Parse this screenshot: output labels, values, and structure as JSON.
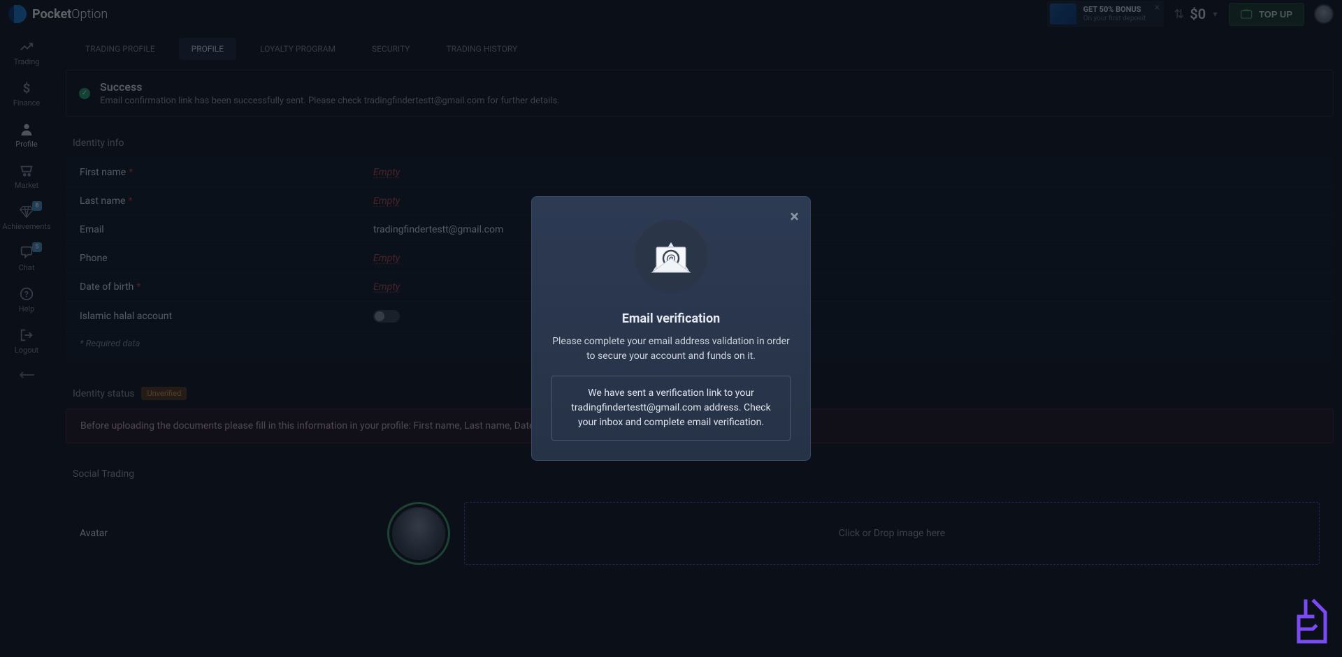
{
  "brand": {
    "name_bold": "Pocket",
    "name_light": "Option"
  },
  "header": {
    "bonus_title": "GET 50% BONUS",
    "bonus_sub": "On your first deposit",
    "balance": "$0",
    "topup_label": "TOP UP"
  },
  "sidebar": {
    "items": [
      {
        "label": "Trading"
      },
      {
        "label": "Finance"
      },
      {
        "label": "Profile"
      },
      {
        "label": "Market"
      },
      {
        "label": "Achievements",
        "badge": "8"
      },
      {
        "label": "Chat",
        "badge": "5"
      },
      {
        "label": "Help"
      },
      {
        "label": "Logout"
      }
    ]
  },
  "tabs": [
    {
      "label": "TRADING PROFILE"
    },
    {
      "label": "PROFILE",
      "active": true
    },
    {
      "label": "LOYALTY PROGRAM"
    },
    {
      "label": "SECURITY"
    },
    {
      "label": "TRADING HISTORY"
    }
  ],
  "alert": {
    "title": "Success",
    "message": "Email confirmation link has been successfully sent. Please check tradingfindertestt@gmail.com for further details."
  },
  "identity_section": {
    "title": "Identity info",
    "fields": {
      "first_name": {
        "label": "First name",
        "required": true,
        "value": "Empty",
        "empty": true
      },
      "last_name": {
        "label": "Last name",
        "required": true,
        "value": "Empty",
        "empty": true
      },
      "email": {
        "label": "Email",
        "required": false,
        "value": "tradingfindertestt@gmail.com",
        "empty": false
      },
      "phone": {
        "label": "Phone",
        "required": false,
        "value": "Empty",
        "empty": true
      },
      "dob": {
        "label": "Date of birth",
        "required": true,
        "value": "Empty",
        "empty": true
      },
      "halal": {
        "label": "Islamic halal account"
      }
    },
    "required_note": "* Required data"
  },
  "identity_status": {
    "label": "Identity status",
    "badge": "Unverified",
    "warning": "Before uploading the documents please fill in this information in your profile: First name, Last name, Date of birth"
  },
  "social": {
    "title": "Social Trading",
    "avatar_label": "Avatar",
    "dropzone": "Click or Drop image here"
  },
  "modal": {
    "title": "Email verification",
    "desc": "Please complete your email address validation in order to secure your account and funds on it.",
    "box": "We have sent a verification link to your tradingfindertestt@gmail.com address. Check your inbox and complete email verification."
  }
}
